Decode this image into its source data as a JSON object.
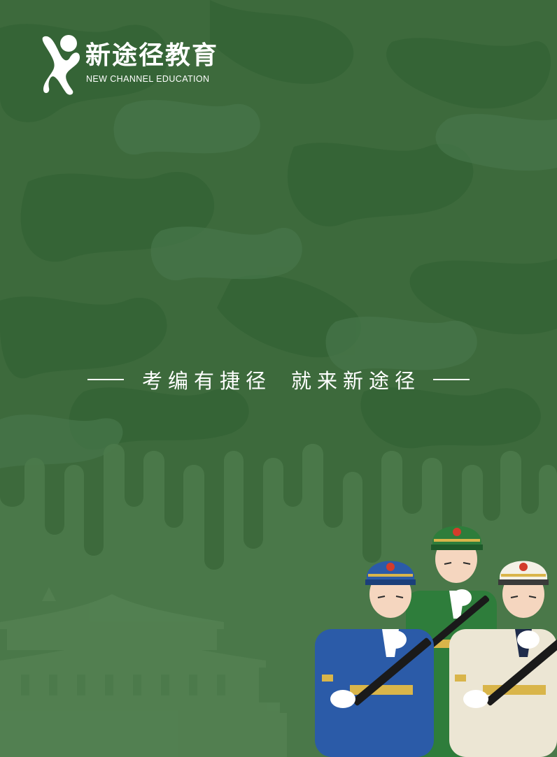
{
  "brand": {
    "name_cn": "新途径教育",
    "name_en": "NEW CHANNEL EDUCATION",
    "logo_icon": "person-x-logo-icon"
  },
  "slogan": {
    "part1": "考编有捷径",
    "part2": "就来新途径"
  },
  "colors": {
    "background": "#3d6a3c",
    "camo_dark": "#2f5c31",
    "camo_light": "#4a7a46",
    "lower_band": "#4b7a4a",
    "text": "#ffffff"
  },
  "decor": {
    "background_pattern": "camouflage-pattern",
    "building_icon": "tiananmen-gate-silhouette-icon",
    "soldiers_icon": "honor-guard-soldiers-illustration"
  }
}
